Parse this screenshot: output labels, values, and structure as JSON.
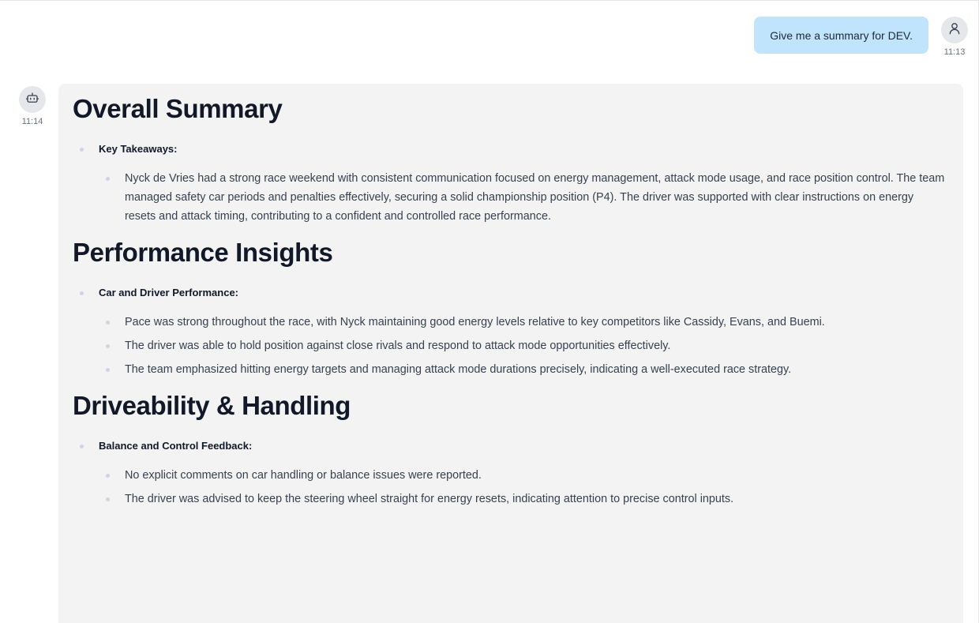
{
  "user_message": {
    "text": "Give me a summary for DEV.",
    "time": "11:13",
    "avatar_icon": "user-icon"
  },
  "bot_message": {
    "time": "11:14",
    "avatar_icon": "robot-icon",
    "sections": [
      {
        "title": "Overall Summary",
        "groups": [
          {
            "label": "Key Takeaways:",
            "items": [
              "Nyck de Vries had a strong race weekend with consistent communication focused on energy management, attack mode usage, and race position control. The team managed safety car periods and penalties effectively, securing a solid championship position (P4). The driver was supported with clear instructions on energy resets and attack timing, contributing to a confident and controlled race performance."
            ]
          }
        ]
      },
      {
        "title": "Performance Insights",
        "groups": [
          {
            "label": "Car and Driver Performance:",
            "items": [
              "Pace was strong throughout the race, with Nyck maintaining good energy levels relative to key competitors like Cassidy, Evans, and Buemi.",
              "The driver was able to hold position against close rivals and respond to attack mode opportunities effectively.",
              "The team emphasized hitting energy targets and managing attack mode durations precisely, indicating a well-executed race strategy."
            ]
          }
        ]
      },
      {
        "title": "Driveability & Handling",
        "groups": [
          {
            "label": "Balance and Control Feedback:",
            "items": [
              "No explicit comments on car handling or balance issues were reported.",
              "The driver was advised to keep the steering wheel straight for energy resets, indicating attention to precise control inputs."
            ]
          }
        ]
      }
    ]
  },
  "colors": {
    "user_bubble": "#bfe4fb",
    "bot_bubble": "#f3f3f3",
    "avatar_bg": "#e5e7eb"
  }
}
